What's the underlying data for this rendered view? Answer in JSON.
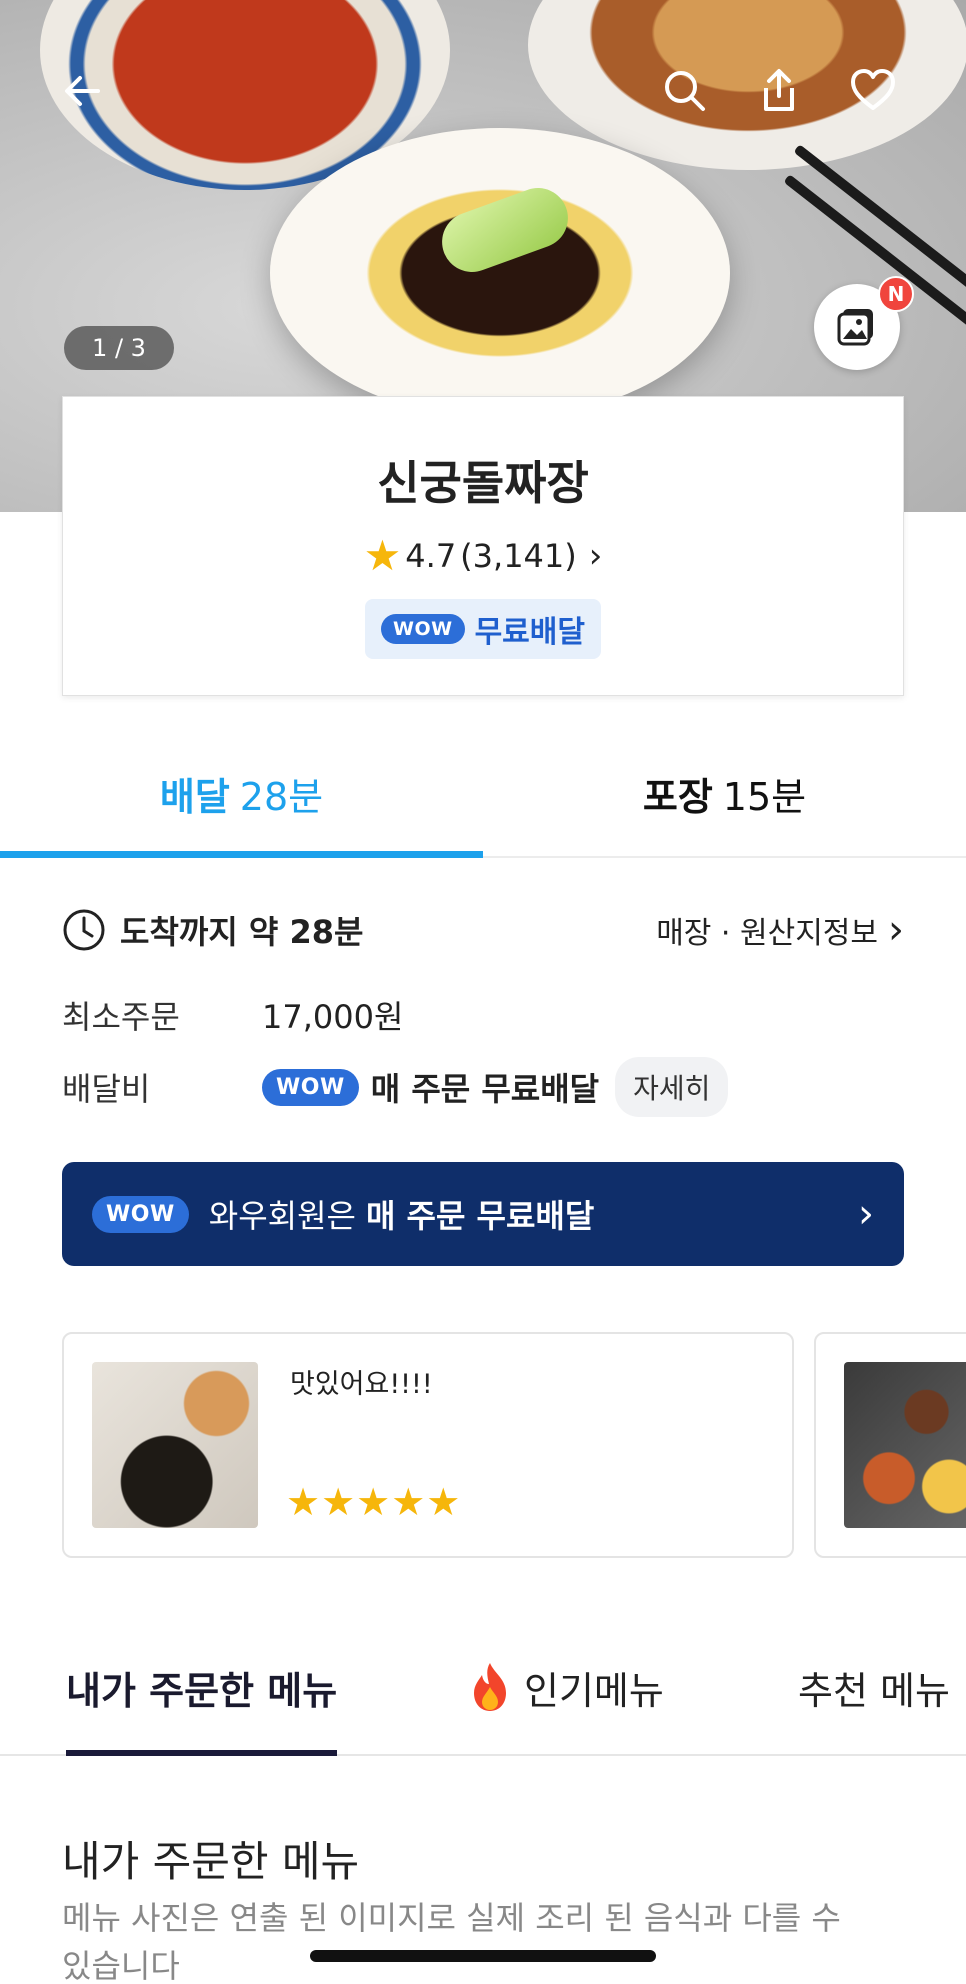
{
  "hero": {
    "image_counter": "1 / 3",
    "new_badge": "N",
    "icons": [
      "back-arrow-icon",
      "search-icon",
      "share-icon",
      "heart-icon",
      "photo-gallery-icon"
    ]
  },
  "store": {
    "name": "신궁돌짜장",
    "rating": "4.7",
    "review_count": "(3,141)",
    "wow_label": "WOW",
    "free_delivery_label": "무료배달"
  },
  "tabs": [
    {
      "label": "배달",
      "time": "28분",
      "active": true
    },
    {
      "label": "포장",
      "time": "15분",
      "active": false
    }
  ],
  "delivery": {
    "arrival_text": "도착까지 약 28분",
    "origin_link": "매장 · 원산지정보",
    "min_order_label": "최소주문",
    "min_order_value": "17,000원",
    "fee_label": "배달비",
    "fee_wow": "WOW",
    "fee_value": "매 주문 무료배달",
    "detail_button": "자세히"
  },
  "wow_banner": {
    "badge": "WOW",
    "text": "와우회원은",
    "bold_text": "매 주문 무료배달"
  },
  "reviews": [
    {
      "text": "맛있어요!!!!",
      "stars": "★★★★★",
      "rating": 5
    }
  ],
  "menu_tabs": [
    {
      "label": "내가 주문한 메뉴",
      "active": true
    },
    {
      "label": "인기메뉴",
      "active": false
    },
    {
      "label": "추천 메뉴",
      "active": false
    }
  ],
  "section": {
    "title": "내가 주문한 메뉴",
    "description": "메뉴 사진은 연출 된 이미지로 실제 조리 된 음식과 다를 수 있습니다"
  },
  "colors": {
    "accent_blue": "#1da1ec",
    "wow_blue": "#2c6ed8",
    "banner_navy": "#0f2e6a",
    "star_yellow": "#f6b60b"
  }
}
